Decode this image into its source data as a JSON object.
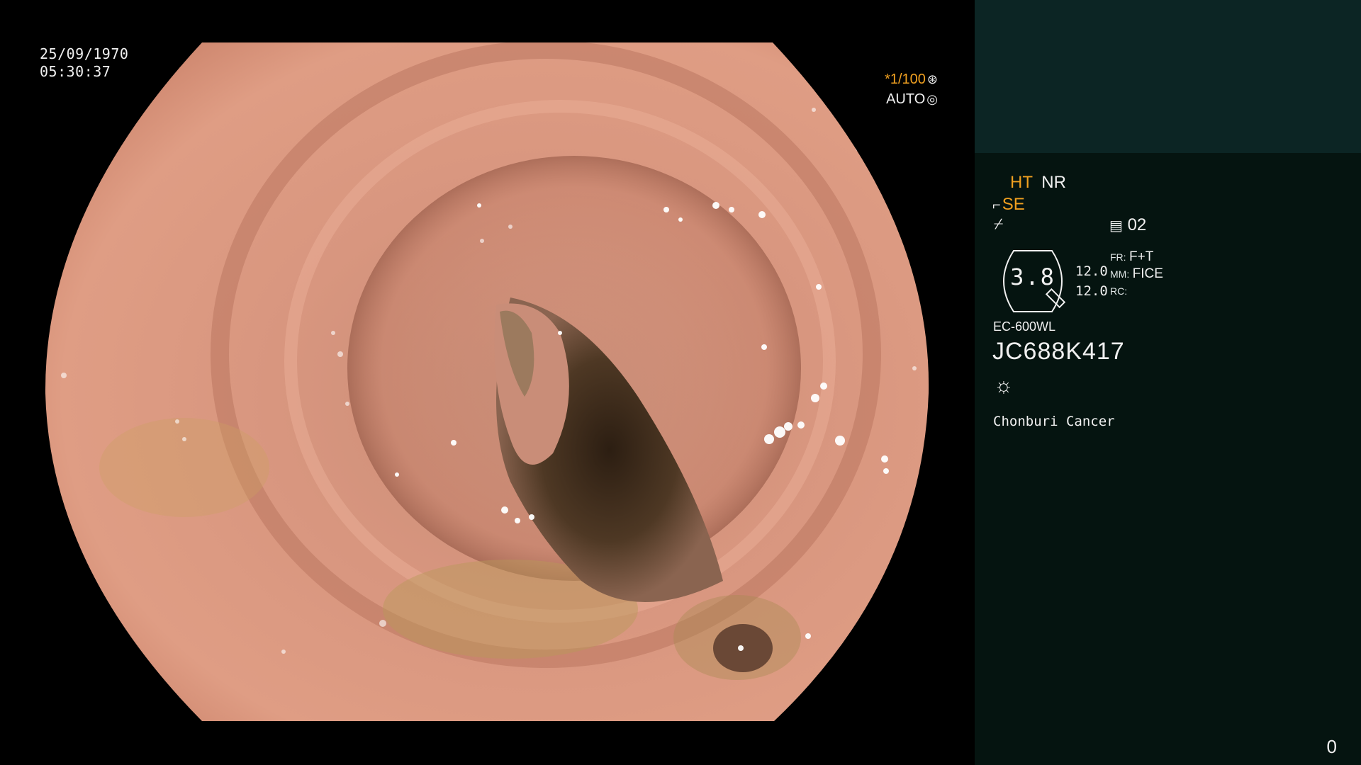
{
  "overlay": {
    "date": "25/09/1970",
    "time": "05:30:37",
    "shutter": "*1/100",
    "shutter_icon": "⊛",
    "exposure_mode": "AUTO",
    "exposure_icon": "◎"
  },
  "panel": {
    "mode_ht": "HT",
    "mode_nr": "NR",
    "se_icon": "⌐",
    "mode_se": "SE",
    "cut_icon": "⌿",
    "image_icon": "▤",
    "image_count": "02",
    "gauge_value": "3.8",
    "val_1": "12.0",
    "val_2": "12.0",
    "fr_label": "FR:",
    "fr_value": "F+T",
    "mm_label": "MM:",
    "mm_value": "FICE",
    "rc_label": "RC:",
    "scope_model": "EC-600WL",
    "serial": "JC688K417",
    "light_icon": "☼",
    "hospital": "Chonburi Cancer"
  },
  "footer": {
    "counter": "0"
  },
  "colors": {
    "accent_orange": "#f0a020",
    "panel_bg": "#051410",
    "panel_top": "#0c2524"
  },
  "icons": [
    "shutter-icon",
    "auto-exposure-icon",
    "structure-enhance-icon",
    "cut-icon",
    "image-counter-icon",
    "light-icon"
  ]
}
